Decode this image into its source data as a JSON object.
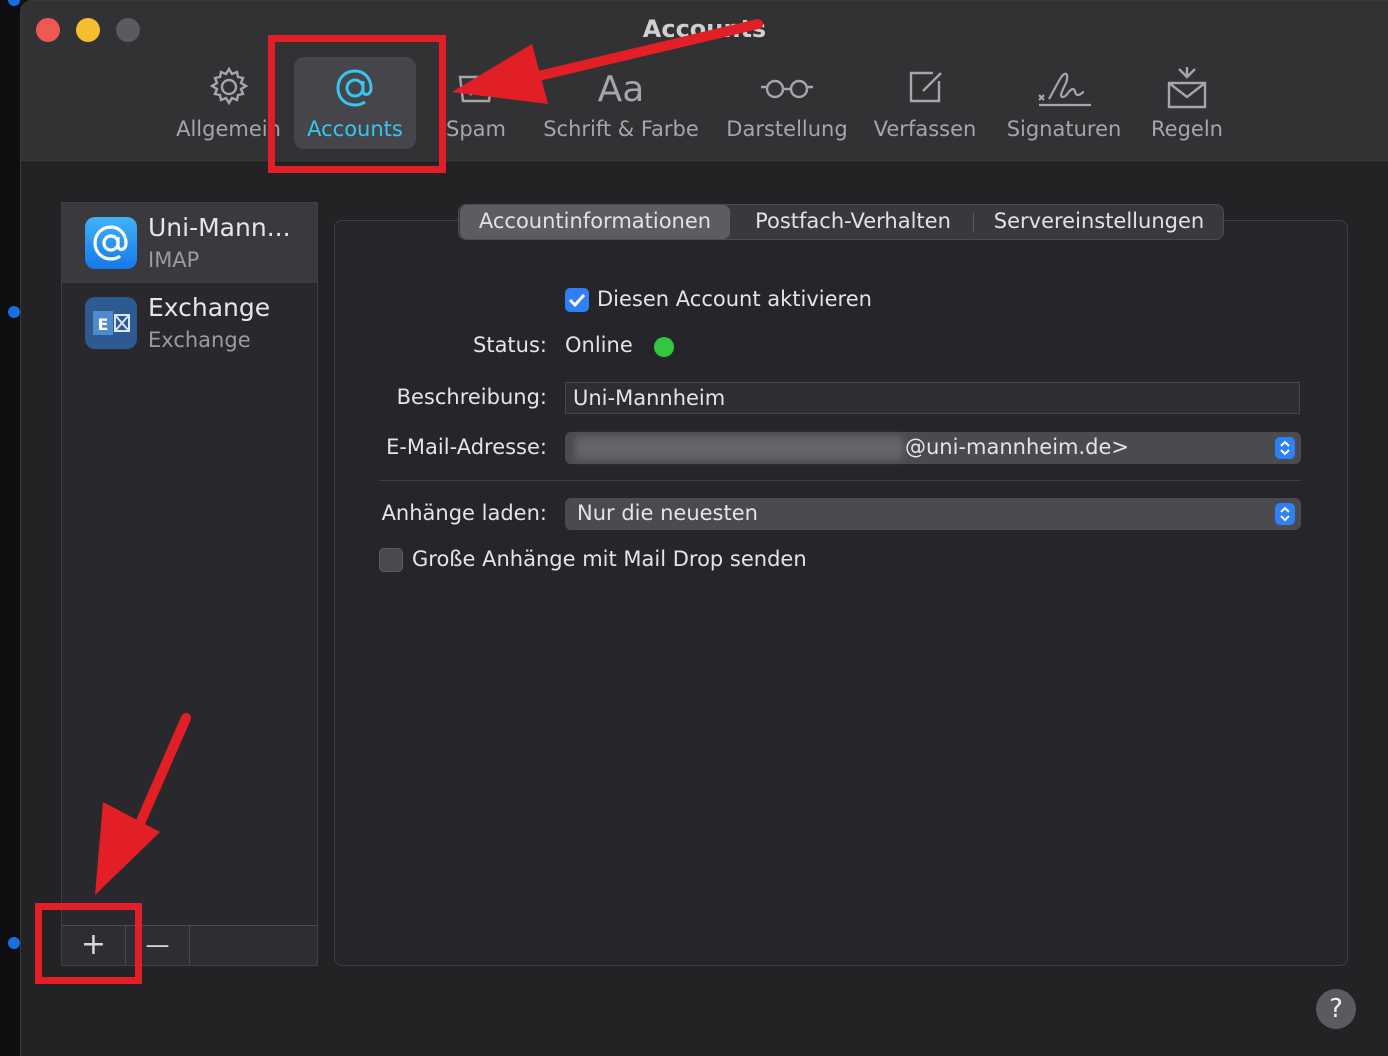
{
  "window": {
    "title": "Accounts"
  },
  "toolbar": {
    "items": [
      {
        "label": "Allgemein",
        "icon": "gear-icon"
      },
      {
        "label": "Accounts",
        "icon": "at-sign-icon",
        "active": true
      },
      {
        "label": "Spam",
        "icon": "junk-tray-icon"
      },
      {
        "label": "Schrift & Farbe",
        "icon": "font-icon"
      },
      {
        "label": "Darstellung",
        "icon": "glasses-icon"
      },
      {
        "label": "Verfassen",
        "icon": "compose-icon"
      },
      {
        "label": "Signaturen",
        "icon": "signature-icon"
      },
      {
        "label": "Regeln",
        "icon": "rules-envelope-icon"
      }
    ]
  },
  "sidebar": {
    "accounts": [
      {
        "name": "Uni-Mann...",
        "type": "IMAP",
        "icon": "mail-at-icon",
        "selected": true
      },
      {
        "name": "Exchange",
        "type": "Exchange",
        "icon": "exchange-icon",
        "selected": false
      }
    ],
    "add_label": "+",
    "remove_label": "—"
  },
  "tabs": {
    "items": [
      "Accountinformationen",
      "Postfach-Verhalten",
      "Servereinstellungen"
    ],
    "active_index": 0
  },
  "form": {
    "enable_account_label": "Diesen Account aktivieren",
    "enable_account_checked": true,
    "status_label": "Status:",
    "status_value": "Online",
    "status_color": "#2fc840",
    "description_label": "Beschreibung:",
    "description_value": "Uni-Mannheim",
    "email_label": "E-Mail-Adresse:",
    "email_value_visible": "@uni-mannheim.de>",
    "attachments_label": "Anhänge laden:",
    "attachments_value": "Nur die neuesten",
    "maildrop_label": "Große Anhänge mit Mail Drop senden",
    "maildrop_checked": false
  },
  "help": {
    "label": "?"
  },
  "colors": {
    "accent": "#2f7ff6",
    "active_toolbar": "#36c6f2",
    "annotation_red": "#e21f26"
  }
}
